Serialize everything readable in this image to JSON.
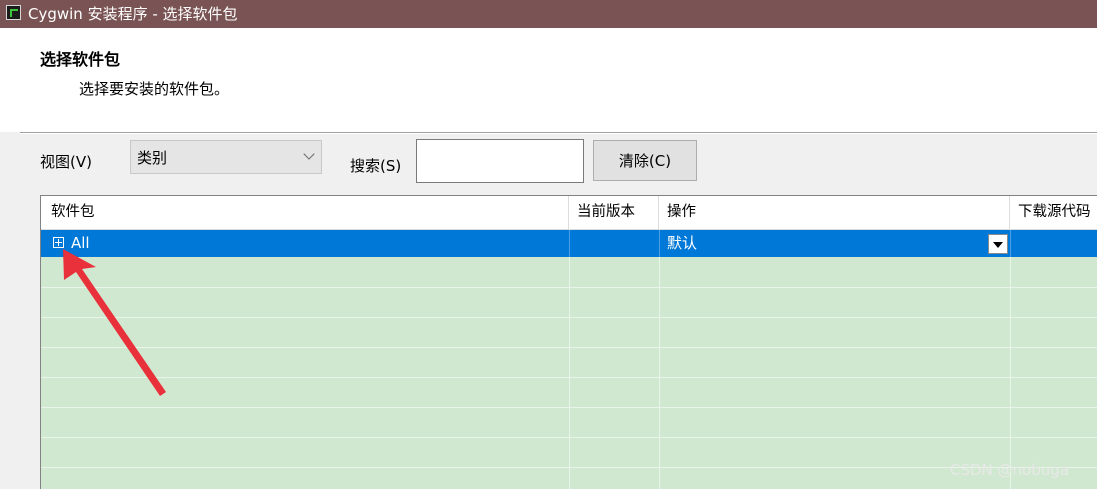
{
  "window": {
    "title": "Cygwin 安装程序 - 选择软件包",
    "icon": "terminal-icon"
  },
  "header": {
    "title": "选择软件包",
    "subtitle": "选择要安装的软件包。"
  },
  "toolbar": {
    "view_label": "视图(V)",
    "view_selected": "类别",
    "search_label": "搜索(S)",
    "search_value": "",
    "clear_label": "清除(C)"
  },
  "table": {
    "columns": [
      "软件包",
      "当前版本",
      "操作",
      "下载源代码"
    ],
    "rows": [
      {
        "package": "All",
        "current_version": "",
        "action": "默认",
        "source": ""
      }
    ]
  },
  "watermark": "CSDN @nobuga",
  "colors": {
    "titlebar": "#7a5454",
    "selection": "#0078d7",
    "row_background": "#cfe8cf",
    "annotation_arrow": "#e8313a"
  }
}
